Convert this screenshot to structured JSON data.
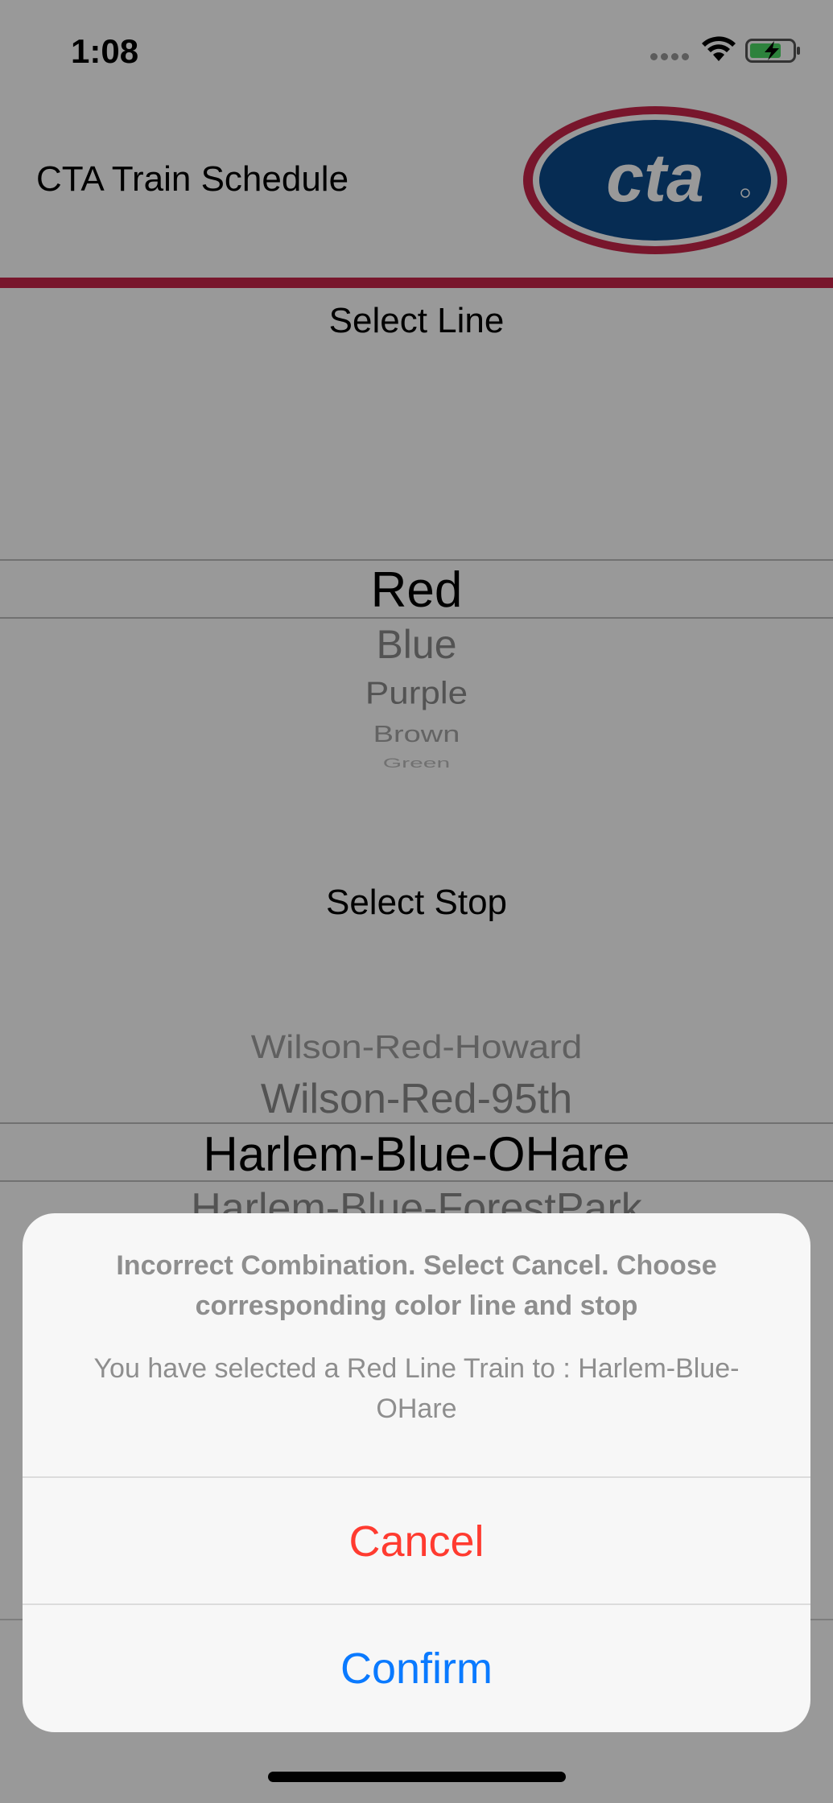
{
  "status_bar": {
    "time": "1:08"
  },
  "header": {
    "title": "CTA Train Schedule",
    "logo_text": "cta"
  },
  "line_picker": {
    "label": "Select Line",
    "items": [
      "Red",
      "Blue",
      "Purple",
      "Brown",
      "Green"
    ],
    "selected": "Red"
  },
  "stop_picker": {
    "label": "Select Stop",
    "items": [
      "Wilson-Red-Howard",
      "Wilson-Red-95th",
      "Harlem-Blue-OHare",
      "Harlem-Blue-ForestPark"
    ],
    "selected": "Harlem-Blue-OHare"
  },
  "alert": {
    "title": "Incorrect Combination. Select Cancel. Choose corresponding color line and stop",
    "message": "You have selected a Red Line Train to : Harlem-Blue-OHare",
    "cancel_label": "Cancel",
    "confirm_label": "Confirm"
  },
  "colors": {
    "accent_rule": "#c8264a",
    "logo_blue": "#0b4a8b",
    "logo_ring": "#c8264a",
    "cancel": "#ff3b30",
    "confirm": "#0a7aff"
  },
  "icons": [
    "signal-icon",
    "wifi-icon",
    "battery-charging-icon",
    "cta-logo"
  ]
}
